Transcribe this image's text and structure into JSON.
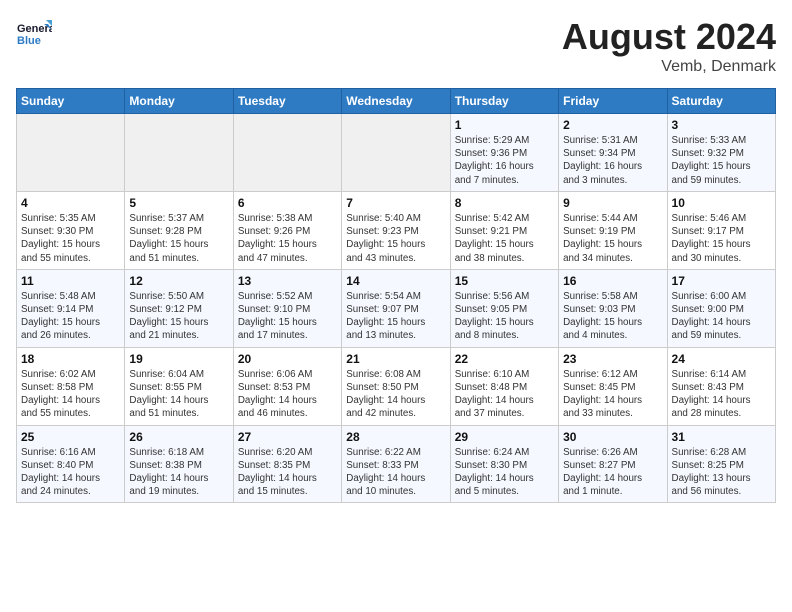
{
  "header": {
    "logo_line1": "General",
    "logo_line2": "Blue",
    "title": "August 2024",
    "subtitle": "Vemb, Denmark"
  },
  "weekdays": [
    "Sunday",
    "Monday",
    "Tuesday",
    "Wednesday",
    "Thursday",
    "Friday",
    "Saturday"
  ],
  "weeks": [
    [
      {
        "day": "",
        "info": ""
      },
      {
        "day": "",
        "info": ""
      },
      {
        "day": "",
        "info": ""
      },
      {
        "day": "",
        "info": ""
      },
      {
        "day": "1",
        "info": "Sunrise: 5:29 AM\nSunset: 9:36 PM\nDaylight: 16 hours\nand 7 minutes."
      },
      {
        "day": "2",
        "info": "Sunrise: 5:31 AM\nSunset: 9:34 PM\nDaylight: 16 hours\nand 3 minutes."
      },
      {
        "day": "3",
        "info": "Sunrise: 5:33 AM\nSunset: 9:32 PM\nDaylight: 15 hours\nand 59 minutes."
      }
    ],
    [
      {
        "day": "4",
        "info": "Sunrise: 5:35 AM\nSunset: 9:30 PM\nDaylight: 15 hours\nand 55 minutes."
      },
      {
        "day": "5",
        "info": "Sunrise: 5:37 AM\nSunset: 9:28 PM\nDaylight: 15 hours\nand 51 minutes."
      },
      {
        "day": "6",
        "info": "Sunrise: 5:38 AM\nSunset: 9:26 PM\nDaylight: 15 hours\nand 47 minutes."
      },
      {
        "day": "7",
        "info": "Sunrise: 5:40 AM\nSunset: 9:23 PM\nDaylight: 15 hours\nand 43 minutes."
      },
      {
        "day": "8",
        "info": "Sunrise: 5:42 AM\nSunset: 9:21 PM\nDaylight: 15 hours\nand 38 minutes."
      },
      {
        "day": "9",
        "info": "Sunrise: 5:44 AM\nSunset: 9:19 PM\nDaylight: 15 hours\nand 34 minutes."
      },
      {
        "day": "10",
        "info": "Sunrise: 5:46 AM\nSunset: 9:17 PM\nDaylight: 15 hours\nand 30 minutes."
      }
    ],
    [
      {
        "day": "11",
        "info": "Sunrise: 5:48 AM\nSunset: 9:14 PM\nDaylight: 15 hours\nand 26 minutes."
      },
      {
        "day": "12",
        "info": "Sunrise: 5:50 AM\nSunset: 9:12 PM\nDaylight: 15 hours\nand 21 minutes."
      },
      {
        "day": "13",
        "info": "Sunrise: 5:52 AM\nSunset: 9:10 PM\nDaylight: 15 hours\nand 17 minutes."
      },
      {
        "day": "14",
        "info": "Sunrise: 5:54 AM\nSunset: 9:07 PM\nDaylight: 15 hours\nand 13 minutes."
      },
      {
        "day": "15",
        "info": "Sunrise: 5:56 AM\nSunset: 9:05 PM\nDaylight: 15 hours\nand 8 minutes."
      },
      {
        "day": "16",
        "info": "Sunrise: 5:58 AM\nSunset: 9:03 PM\nDaylight: 15 hours\nand 4 minutes."
      },
      {
        "day": "17",
        "info": "Sunrise: 6:00 AM\nSunset: 9:00 PM\nDaylight: 14 hours\nand 59 minutes."
      }
    ],
    [
      {
        "day": "18",
        "info": "Sunrise: 6:02 AM\nSunset: 8:58 PM\nDaylight: 14 hours\nand 55 minutes."
      },
      {
        "day": "19",
        "info": "Sunrise: 6:04 AM\nSunset: 8:55 PM\nDaylight: 14 hours\nand 51 minutes."
      },
      {
        "day": "20",
        "info": "Sunrise: 6:06 AM\nSunset: 8:53 PM\nDaylight: 14 hours\nand 46 minutes."
      },
      {
        "day": "21",
        "info": "Sunrise: 6:08 AM\nSunset: 8:50 PM\nDaylight: 14 hours\nand 42 minutes."
      },
      {
        "day": "22",
        "info": "Sunrise: 6:10 AM\nSunset: 8:48 PM\nDaylight: 14 hours\nand 37 minutes."
      },
      {
        "day": "23",
        "info": "Sunrise: 6:12 AM\nSunset: 8:45 PM\nDaylight: 14 hours\nand 33 minutes."
      },
      {
        "day": "24",
        "info": "Sunrise: 6:14 AM\nSunset: 8:43 PM\nDaylight: 14 hours\nand 28 minutes."
      }
    ],
    [
      {
        "day": "25",
        "info": "Sunrise: 6:16 AM\nSunset: 8:40 PM\nDaylight: 14 hours\nand 24 minutes."
      },
      {
        "day": "26",
        "info": "Sunrise: 6:18 AM\nSunset: 8:38 PM\nDaylight: 14 hours\nand 19 minutes."
      },
      {
        "day": "27",
        "info": "Sunrise: 6:20 AM\nSunset: 8:35 PM\nDaylight: 14 hours\nand 15 minutes."
      },
      {
        "day": "28",
        "info": "Sunrise: 6:22 AM\nSunset: 8:33 PM\nDaylight: 14 hours\nand 10 minutes."
      },
      {
        "day": "29",
        "info": "Sunrise: 6:24 AM\nSunset: 8:30 PM\nDaylight: 14 hours\nand 5 minutes."
      },
      {
        "day": "30",
        "info": "Sunrise: 6:26 AM\nSunset: 8:27 PM\nDaylight: 14 hours\nand 1 minute."
      },
      {
        "day": "31",
        "info": "Sunrise: 6:28 AM\nSunset: 8:25 PM\nDaylight: 13 hours\nand 56 minutes."
      }
    ]
  ]
}
